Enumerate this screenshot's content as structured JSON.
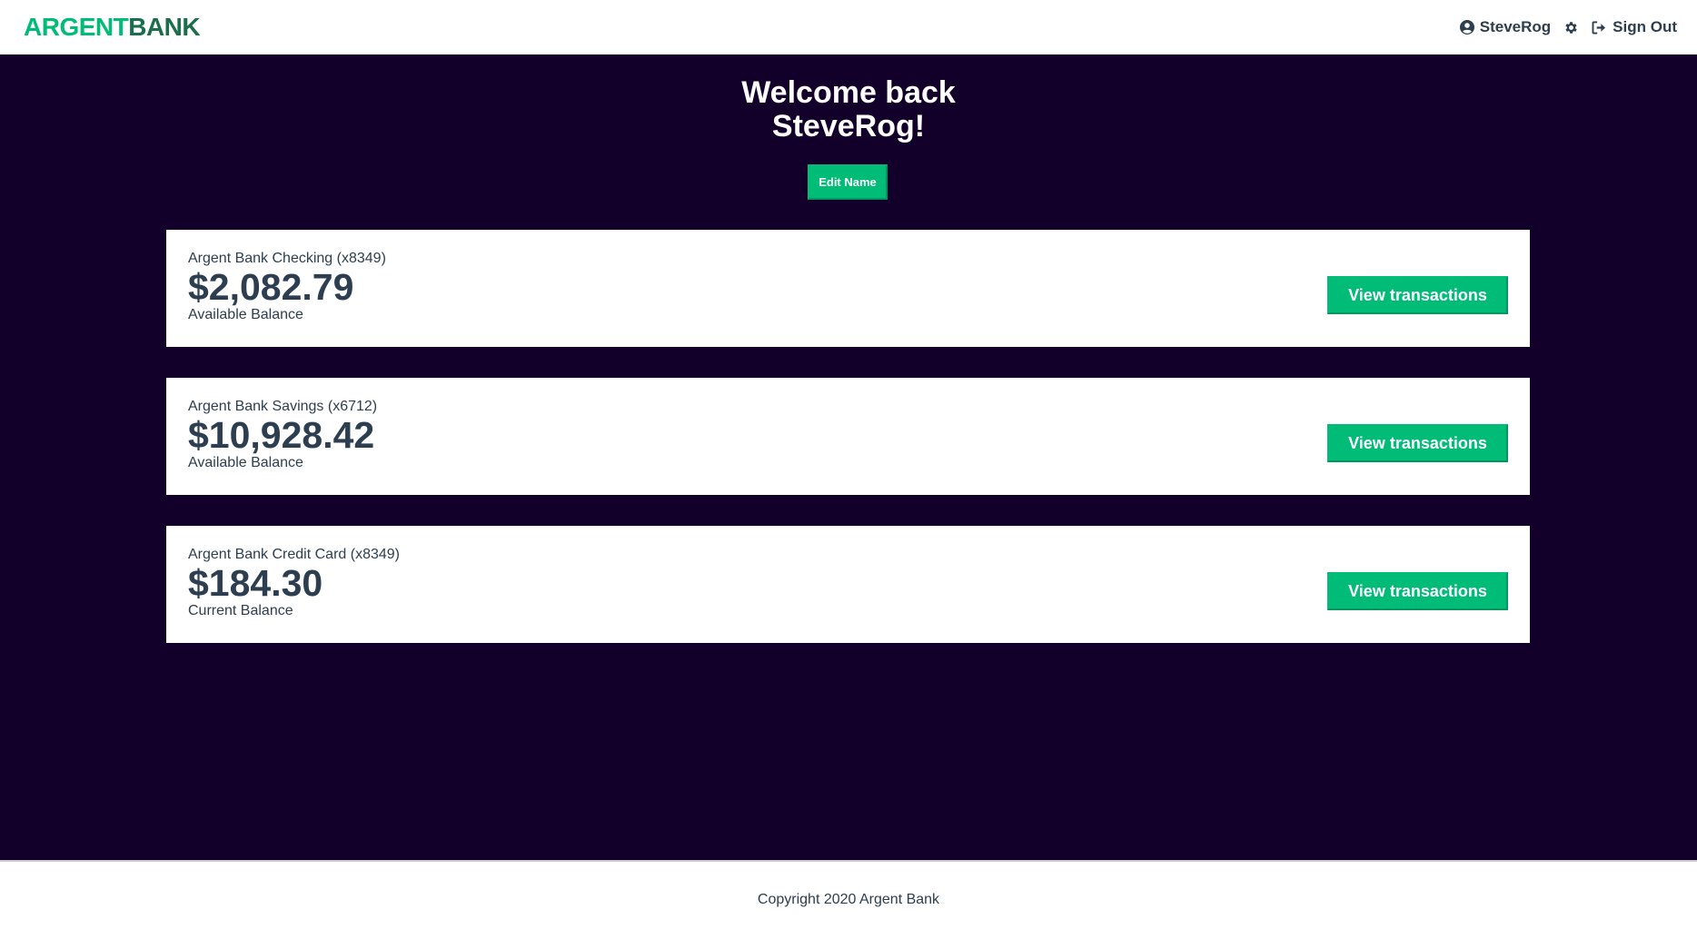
{
  "brand": {
    "logo_part1": "ARGENT",
    "logo_part2": "BANK",
    "colors": {
      "primary": "#00bc77",
      "dark": "#12002b",
      "text": "#2c3e50"
    }
  },
  "nav": {
    "user_icon": "user-circle-icon",
    "username": "SteveRog",
    "settings_icon": "gear-icon",
    "signout_icon": "sign-out-icon",
    "signout_label": "Sign Out"
  },
  "header": {
    "welcome_line1": "Welcome back",
    "welcome_line2": "SteveRog!",
    "edit_button": "Edit Name"
  },
  "accounts": [
    {
      "title": "Argent Bank Checking (x8349)",
      "amount": "$2,082.79",
      "description": "Available Balance",
      "button": "View transactions"
    },
    {
      "title": "Argent Bank Savings (x6712)",
      "amount": "$10,928.42",
      "description": "Available Balance",
      "button": "View transactions"
    },
    {
      "title": "Argent Bank Credit Card (x8349)",
      "amount": "$184.30",
      "description": "Current Balance",
      "button": "View transactions"
    }
  ],
  "footer": {
    "copyright": "Copyright 2020 Argent Bank"
  }
}
